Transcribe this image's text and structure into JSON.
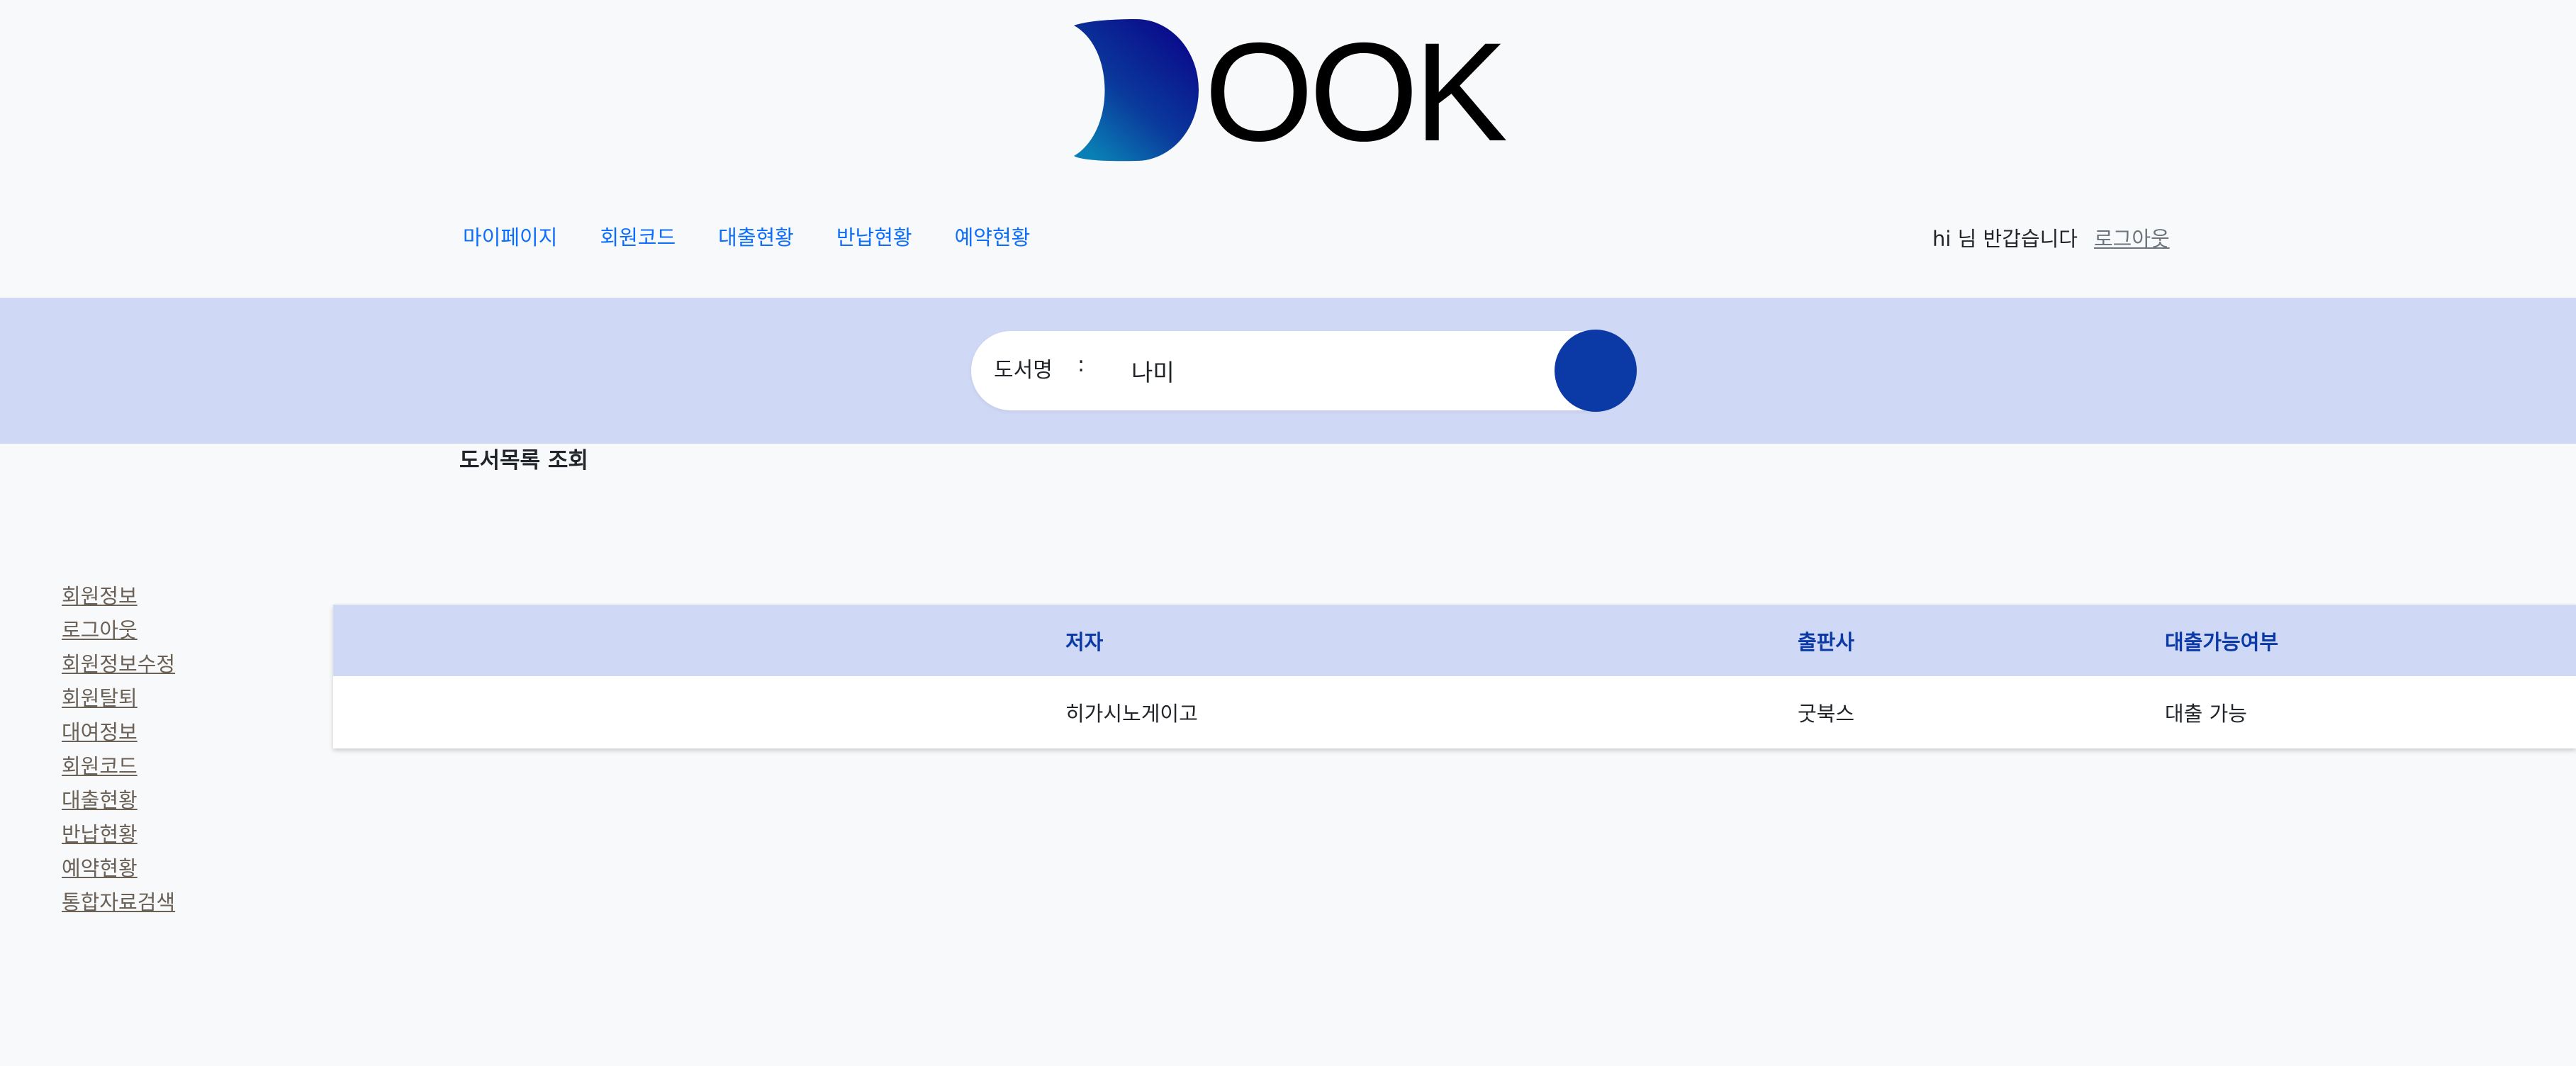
{
  "logo": {
    "text": "OOK",
    "colors": {
      "gradient_start": "#0a0d8c",
      "gradient_end": "#0a7fb5"
    }
  },
  "nav": {
    "items": [
      "마이페이지",
      "회원코드",
      "대출현황",
      "반납현황",
      "예약현황"
    ],
    "greeting": "hi 님 반갑습니다",
    "logout": "로그아웃"
  },
  "search": {
    "label": "도서명",
    "colon": ":",
    "value": "나미",
    "button_color": "#0b3aa6"
  },
  "section_title": "도서목록 조회",
  "sidebar": {
    "items": [
      "회원정보",
      "로그아웃",
      "회원정보수정",
      "회원탈퇴",
      "대여정보",
      "회원코드",
      "대출현황",
      "반납현황",
      "예약현황",
      "통합자료검색"
    ]
  },
  "table": {
    "headers": {
      "author": "저자",
      "publisher": "출판사",
      "available": "대출가능여부"
    },
    "rows": [
      {
        "author": "히가시노게이고",
        "publisher": "굿북스",
        "available": "대출 가능"
      }
    ]
  },
  "colors": {
    "accent": "#0d6efd",
    "band": "#cfd8f5",
    "header_text": "#0b3aa6"
  }
}
